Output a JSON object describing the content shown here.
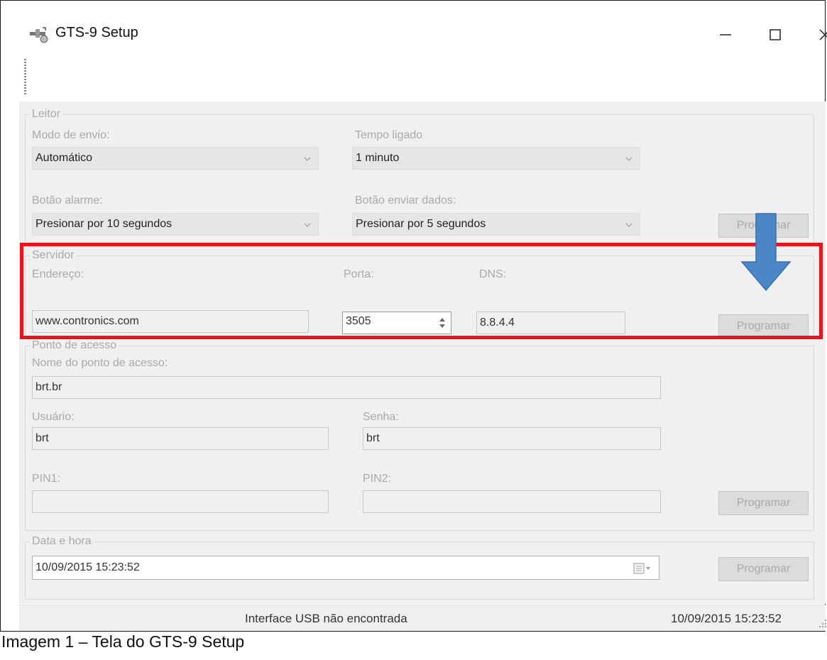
{
  "window": {
    "title": "GTS-9 Setup"
  },
  "leitor": {
    "legend": "Leitor",
    "modo_envio": {
      "label": "Modo de envio:",
      "value": "Automático"
    },
    "tempo_ligado": {
      "label": "Tempo ligado",
      "value": "1 minuto"
    },
    "botao_alarme": {
      "label": "Botão alarme:",
      "value": "Presionar por 10 segundos"
    },
    "botao_enviar": {
      "label": "Botão enviar dados:",
      "value": "Presionar por 5 segundos"
    },
    "program_label": "Programar"
  },
  "servidor": {
    "legend": "Servidor",
    "endereco": {
      "label": "Endereço:",
      "value": "www.contronics.com"
    },
    "porta": {
      "label": "Porta:",
      "value": "3505"
    },
    "dns": {
      "label": "DNS:",
      "value": "8.8.4.4"
    },
    "program_label": "Programar"
  },
  "ponto_acesso": {
    "legend": "Ponto de acesso",
    "nome": {
      "label": "Nome do ponto de acesso:",
      "value": "brt.br"
    },
    "usuario": {
      "label": "Usuário:",
      "value": "brt"
    },
    "senha": {
      "label": "Senha:",
      "value": "brt"
    },
    "pin1": {
      "label": "PIN1:",
      "value": ""
    },
    "pin2": {
      "label": "PIN2:",
      "value": ""
    },
    "program_label": "Programar"
  },
  "data_hora": {
    "legend": "Data e hora",
    "value": "10/09/2015 15:23:52",
    "program_label": "Programar"
  },
  "statusbar": {
    "message": "Interface USB não encontrada",
    "datetime": "10/09/2015 15:23:52"
  },
  "caption": "Imagem 1 – Tela do GTS-9 Setup",
  "colors": {
    "highlight": "#e8151f",
    "arrow": "#4a86c8",
    "disabled_text": "#a9a9a9"
  },
  "icons": [
    "app-logo-icon",
    "minimize-icon",
    "maximize-icon",
    "close-icon",
    "chevron-down-icon",
    "spinner-icon",
    "calendar-icon",
    "resize-grip-icon",
    "down-arrow-icon"
  ]
}
